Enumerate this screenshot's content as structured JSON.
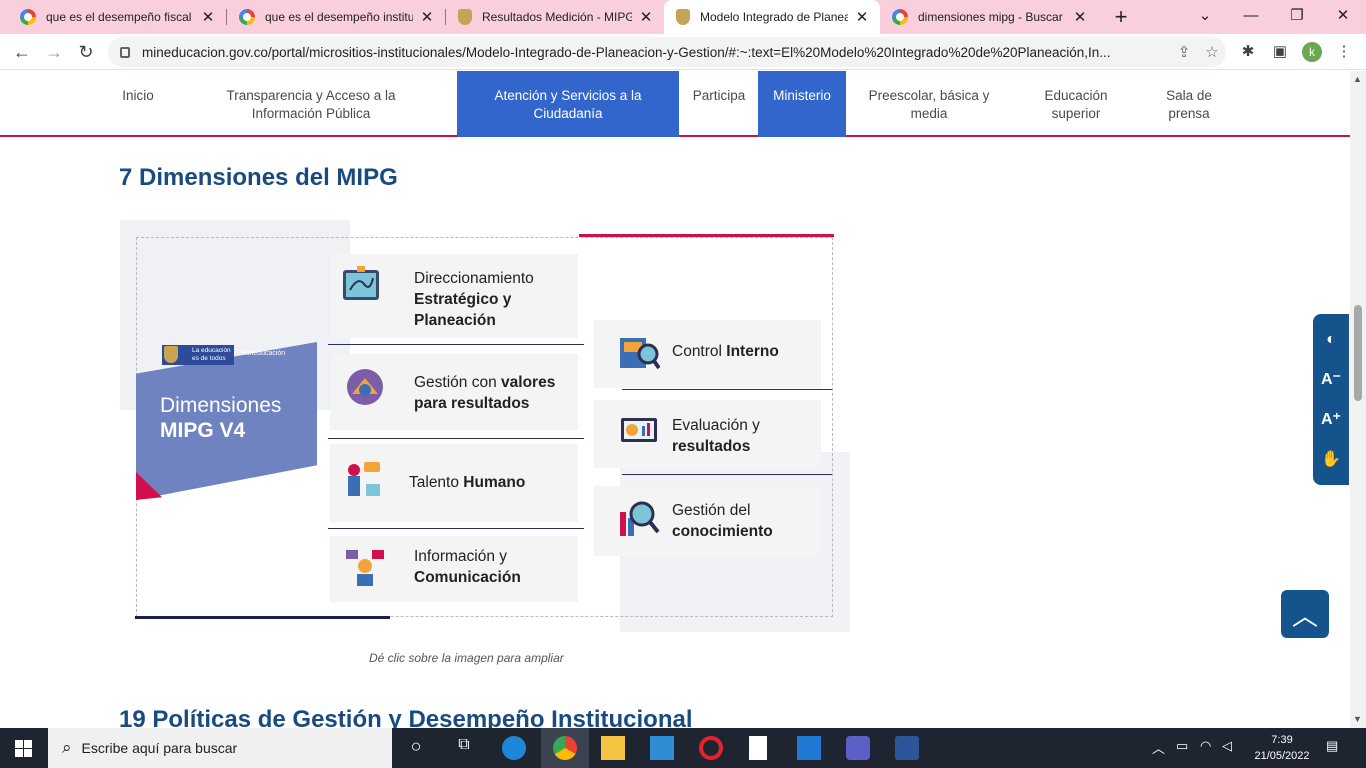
{
  "browser": {
    "tabs": [
      {
        "title": "que es el desempeño fiscal d",
        "icon": "google-icon",
        "active": false
      },
      {
        "title": "que es el desempeño instituc",
        "icon": "google-icon",
        "active": false
      },
      {
        "title": "Resultados Medición - MIPG",
        "icon": "crest-icon",
        "active": false
      },
      {
        "title": "Modelo Integrado de Planea",
        "icon": "crest-icon",
        "active": true
      },
      {
        "title": "dimensiones mipg - Buscar c",
        "icon": "google-icon",
        "active": false
      }
    ],
    "url": "mineducacion.gov.co/portal/micrositios-institucionales/Modelo-Integrado-de-Planeacion-y-Gestion/#:~:text=El%20Modelo%20Integrado%20de%20Planeación,In...",
    "profile_initial": "k"
  },
  "sitenav": {
    "items": [
      {
        "label": "Inicio"
      },
      {
        "label": "Transparencia y Acceso a la Información Pública"
      },
      {
        "label": "Atención y Servicios a la Ciudadanía"
      },
      {
        "label": "Participa"
      },
      {
        "label": "Ministerio"
      },
      {
        "label": "Preescolar, básica y media"
      },
      {
        "label": "Educación superior"
      },
      {
        "label": "Sala de prensa"
      }
    ],
    "highlight_color": "#3366cc",
    "border_color": "#d0104c"
  },
  "content": {
    "heading1": "7 Dimensiones del MIPG",
    "heading2": "19 Políticas de Gestión y Desempeño Institucional",
    "caption": "Dé clic sobre la imagen para ampliar",
    "figure": {
      "logo_text": "La educación es de todos",
      "logo_sub": "Mineducación",
      "banner_line1": "Dimensiones",
      "banner_line2": "MIPG V4",
      "dimensions": [
        {
          "normal": "Direccionamiento",
          "bold": "Estratégico y Planeación",
          "icon": "strategy-board-icon"
        },
        {
          "normal": "Gestión con",
          "bold": "valores para resultados",
          "icon": "hands-together-icon"
        },
        {
          "normal": "Talento",
          "bold": "Humano",
          "icon": "people-chat-icon"
        },
        {
          "normal": "Información y",
          "bold": "Comunicación",
          "icon": "communication-icon"
        },
        {
          "normal": "Control",
          "bold": "Interno",
          "icon": "audit-magnifier-icon"
        },
        {
          "normal": "Evaluación y",
          "bold": "resultados",
          "icon": "analytics-screen-icon"
        },
        {
          "normal": "Gestión del",
          "bold": "conocimiento",
          "icon": "knowledge-search-icon"
        }
      ]
    }
  },
  "taskbar": {
    "search_placeholder": "Escribe aquí para buscar",
    "time": "7:39",
    "date": "21/05/2022"
  }
}
